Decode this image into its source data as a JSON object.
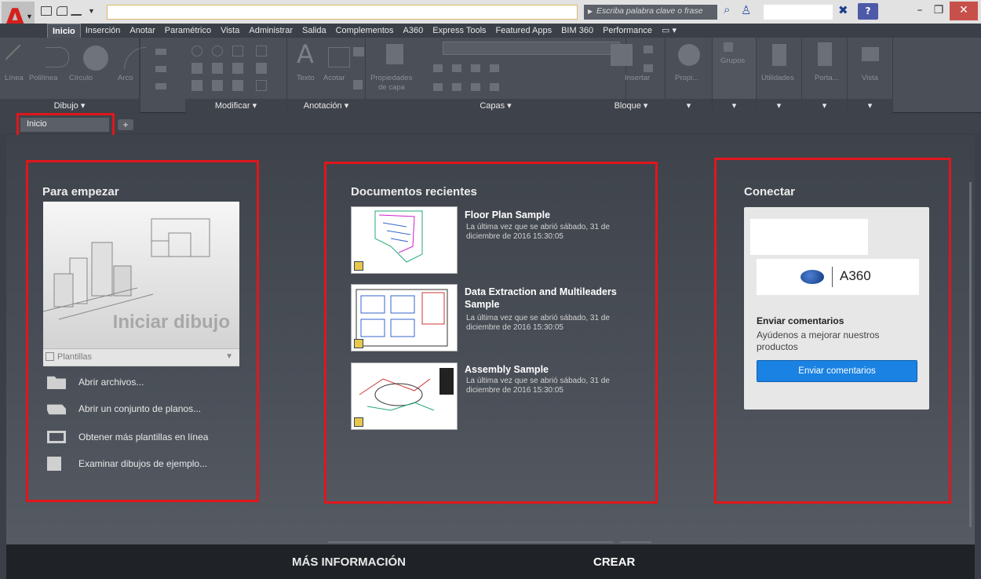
{
  "titlebar": {
    "search_placeholder": "Escriba palabra clave o frase",
    "help_label": "?"
  },
  "menu": {
    "tabs": [
      "Inicio",
      "Inserción",
      "Anotar",
      "Paramétrico",
      "Vista",
      "Administrar",
      "Salida",
      "Complementos",
      "A360",
      "Express Tools",
      "Featured Apps",
      "BIM 360",
      "Performance"
    ]
  },
  "ribbon": {
    "draw": {
      "title": "Dibujo ▾",
      "tools": [
        "Línea",
        "Polilínea",
        "Círculo",
        "Arco"
      ]
    },
    "modify": {
      "title": "Modificar ▾"
    },
    "annotation": {
      "title": "Anotación ▾",
      "tools": [
        "Texto",
        "Acotar"
      ]
    },
    "layers": {
      "title": "Capas ▾",
      "tools": [
        "Propiedades",
        "de capa"
      ]
    },
    "block": {
      "title": "Bloque ▾",
      "tools": [
        "Insertar"
      ]
    },
    "properties": {
      "title": "▾",
      "label": "Propi..."
    },
    "groups": {
      "title": "▾",
      "label": "Grupos"
    },
    "utilities": {
      "title": "▾",
      "label": "Utilidades"
    },
    "clipboard": {
      "title": "▾",
      "label": "Porta..."
    },
    "view": {
      "title": "▾",
      "label": "Vista"
    }
  },
  "doctabs": {
    "active": "Inicio",
    "add": "+"
  },
  "start": {
    "title": "Para empezar",
    "big_label": "Iniciar dibujo",
    "templates": "Plantillas",
    "links": [
      "Abrir archivos...",
      "Abrir un conjunto de planos...",
      "Obtener más plantillas en línea",
      "Examinar dibujos de ejemplo..."
    ]
  },
  "recent": {
    "title": "Documentos recientes",
    "docs": [
      {
        "name": "Floor Plan Sample",
        "meta": "La última vez que se abrió sábado, 31 de diciembre de 2016 15:30:05"
      },
      {
        "name": "Data Extraction and Multileaders Sample",
        "meta": "La última vez que se abrió sábado, 31 de diciembre de 2016 15:30:05"
      },
      {
        "name": "Assembly Sample",
        "meta": "La última vez que se abrió sábado, 31 de diciembre de 2016 15:30:05"
      }
    ]
  },
  "connect": {
    "title": "Conectar",
    "a360_label": "A360",
    "feedback_title": "Enviar comentarios",
    "feedback_desc": "Ayúdenos a mejorar nuestros productos",
    "feedback_button": "Enviar comentarios"
  },
  "bottom": {
    "learn": "MÁS INFORMACIÓN",
    "create": "CREAR"
  },
  "colors": {
    "highlight": "#e0161c",
    "accent_button": "#1a82e2",
    "logo_red": "#d5201d"
  }
}
